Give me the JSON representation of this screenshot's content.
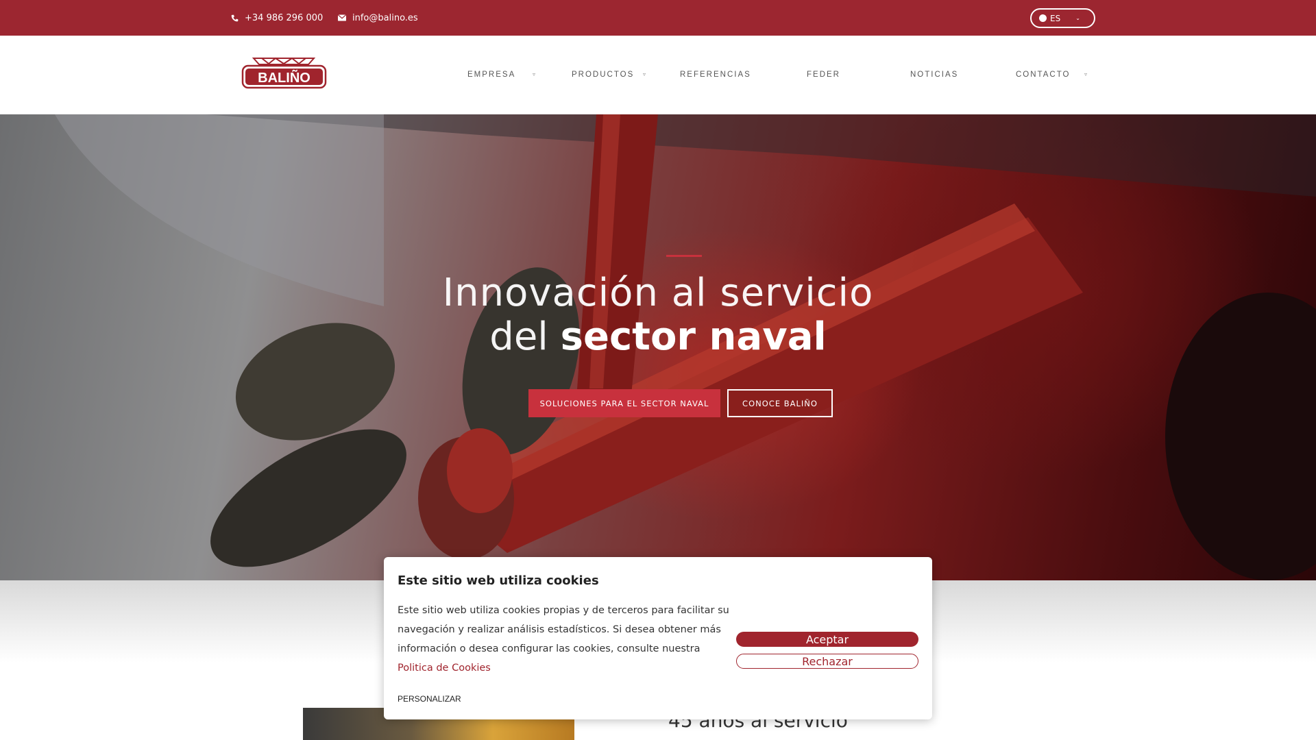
{
  "topbar": {
    "phone": "+34 986 296 000",
    "email": "info@balino.es",
    "language": "ES",
    "colors": {
      "background": "#9c2630"
    }
  },
  "header": {
    "logo_text": "BALIÑO",
    "nav": [
      {
        "label": "EMPRESA",
        "has_dropdown": true
      },
      {
        "label": "PRODUCTOS",
        "has_dropdown": true
      },
      {
        "label": "REFERENCIAS",
        "has_dropdown": false
      },
      {
        "label": "FEDER",
        "has_dropdown": false
      },
      {
        "label": "NOTICIAS",
        "has_dropdown": false
      },
      {
        "label": "CONTACTO",
        "has_dropdown": true
      }
    ]
  },
  "hero": {
    "title_line1": "Innovación al servicio",
    "title_line2_light": "del",
    "title_line2_bold": "sector naval",
    "primary_button": "SOLUCIONES PARA EL SECTOR NAVAL",
    "secondary_button": "CONOCE BALIÑO",
    "accent_color": "#c8313d"
  },
  "section": {
    "title_partial": "45 años al servicio"
  },
  "cookie_dialog": {
    "title": "Este sitio web utiliza cookies",
    "body": "Este sitio web utiliza cookies propias y de terceros para facilitar su navegación y realizar análisis estadísticos. Si desea obtener más información o desea configurar las cookies, consulte nuestra",
    "link_text": "Politica de Cookies",
    "accept_label": "Aceptar",
    "reject_label": "Rechazar",
    "customize_label": "PERSONALIZAR",
    "brand_color": "#a0242d"
  }
}
